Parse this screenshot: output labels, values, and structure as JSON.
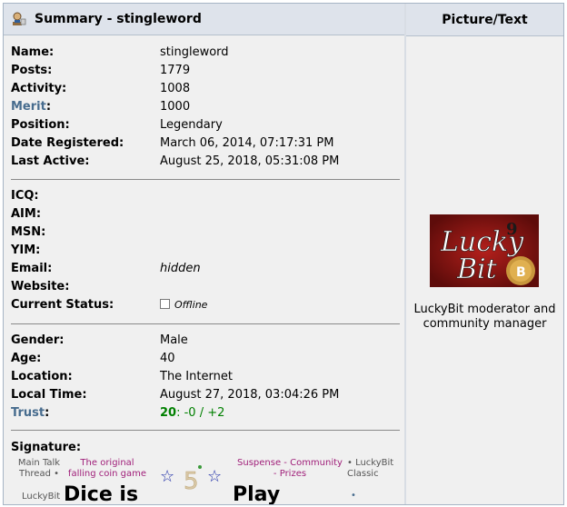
{
  "header": {
    "title": "Summary - stingleword",
    "right_title": "Picture/Text"
  },
  "summary": [
    {
      "label": "Name:",
      "value": "stingleword"
    },
    {
      "label": "Posts:",
      "value": "1779"
    },
    {
      "label": "Activity:",
      "value": "1008"
    },
    {
      "label": "Merit",
      "suffix": ":",
      "value": "1000"
    },
    {
      "label": "Position:",
      "value": "Legendary"
    },
    {
      "label": "Date Registered:",
      "value": "March 06, 2014, 07:17:31 PM"
    },
    {
      "label": "Last Active:",
      "value": "August 25, 2018, 05:31:08 PM"
    }
  ],
  "contact": [
    {
      "label": "ICQ:",
      "value": ""
    },
    {
      "label": "AIM:",
      "value": ""
    },
    {
      "label": "MSN:",
      "value": ""
    },
    {
      "label": "YIM:",
      "value": ""
    },
    {
      "label": "Email:",
      "value": "hidden"
    },
    {
      "label": "Website:",
      "value": ""
    },
    {
      "label": "Current Status:",
      "value": "Offline"
    }
  ],
  "personal": [
    {
      "label": "Gender:",
      "value": "Male"
    },
    {
      "label": "Age:",
      "value": "40"
    },
    {
      "label": "Location:",
      "value": "The Internet"
    },
    {
      "label": "Local Time:",
      "value": "August 27, 2018, 03:04:26 PM"
    },
    {
      "label": "Trust",
      "suffix": ":",
      "trust_score": "20",
      "trust_rest": ": -0 / +2"
    }
  ],
  "signature": {
    "label": "Signature:",
    "items": [
      {
        "text": "Main Talk Thread •"
      },
      {
        "text": "The original falling coin game"
      },
      {
        "text": "Suspense - Community - Prizes"
      },
      {
        "text": "• LuckyBit Classic"
      }
    ],
    "big_words": [
      "Dice is",
      "Play"
    ],
    "partial": "LuckyBit",
    "bullet": "•"
  },
  "picture": {
    "logo_text_1": "Lucky",
    "logo_text_2": "Bit",
    "caption": "LuckyBit moderator and community manager"
  }
}
